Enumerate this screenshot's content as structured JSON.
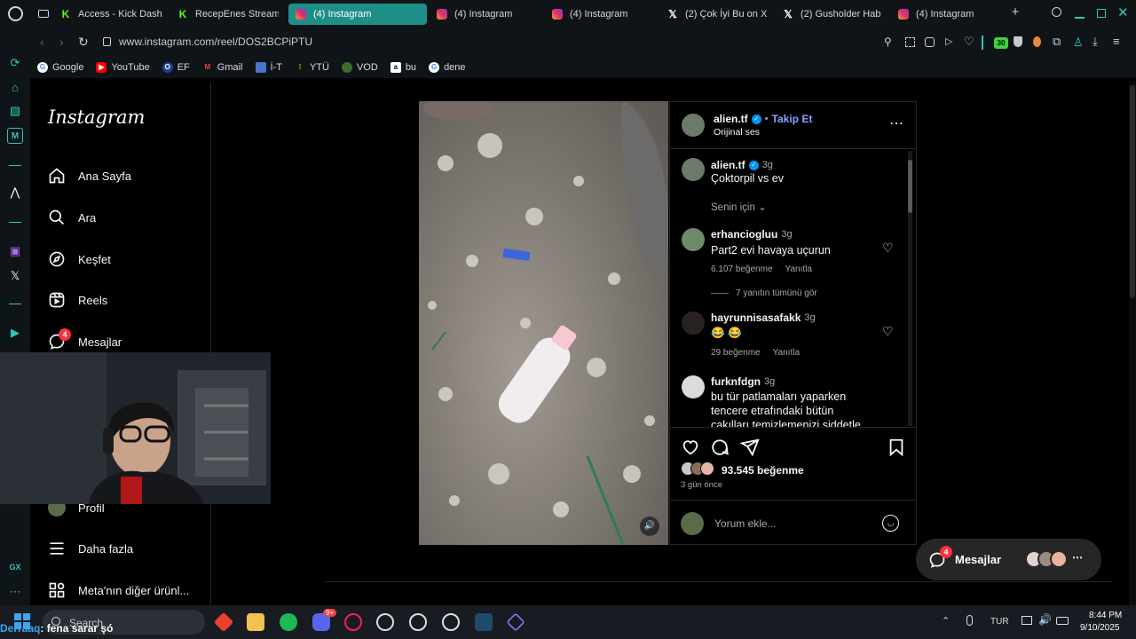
{
  "tabs": [
    {
      "label": "Access - Kick Dash",
      "icon": "kick-icon"
    },
    {
      "label": "RecepEnes Stream",
      "icon": "kick-icon"
    },
    {
      "label": "(4) Instagram",
      "icon": "instagram-icon",
      "active": true
    },
    {
      "label": "(4) Instagram",
      "icon": "instagram-icon"
    },
    {
      "label": "(4) Instagram",
      "icon": "instagram-icon"
    },
    {
      "label": "(2) Çok İyi Bu on X",
      "icon": "x-icon"
    },
    {
      "label": "(2) Gusholder Hab",
      "icon": "x-icon"
    },
    {
      "label": "(4) Instagram",
      "icon": "instagram-icon"
    }
  ],
  "address": {
    "url": "www.instagram.com/reel/DOS2BCPiPTU"
  },
  "bookmarks": [
    "Google",
    "YouTube",
    "EF",
    "Gmail",
    "İ-T",
    "YTÜ",
    "VOD",
    "bu",
    "dene"
  ],
  "toolbar": {
    "badge_count": "30"
  },
  "instagram": {
    "logo": "Instagram",
    "nav": {
      "home": "Ana Sayfa",
      "search": "Ara",
      "explore": "Keşfet",
      "reels": "Reels",
      "messages": "Mesajlar",
      "messages_badge": "4",
      "profile": "Profil",
      "more": "Daha fazla",
      "meta": "Meta'nın diğer ürünl..."
    }
  },
  "post": {
    "author": "alien.tf",
    "follow": "Takip Et",
    "dot": "•",
    "audio": "Orijinal ses",
    "caption_time": "3g",
    "caption": "Çoktorpil vs ev",
    "sort_label": "Senin için",
    "likes": "93.545 beğenme",
    "date": "3 gün önce",
    "comment_placeholder": "Yorum ekle..."
  },
  "comments": [
    {
      "user": "erhanciogluu",
      "time": "3g",
      "text": "Part2 evi havaya uçurun",
      "likes": "6.107 beğenme",
      "reply": "Yanıtla",
      "view_replies": "7 yanıtın tümünü gör"
    },
    {
      "user": "hayrunnisasafakk",
      "time": "3g",
      "text": "😂 😂",
      "likes": "29 beğenme",
      "reply": "Yanıtla"
    },
    {
      "user": "furknfdgn",
      "time": "3g",
      "text": "bu tür patlamaları yaparken tencere etrafındaki bütün çakılları temizlemenizi şiddetle"
    }
  ],
  "messages_pill": {
    "label": "Mesajlar",
    "badge": "4"
  },
  "overlay": {
    "chat_user": "Derraaq",
    "chat_text": ": fena sarar şó"
  },
  "taskbar": {
    "search": "Search",
    "discord_badge": "9+",
    "lang": "TUR",
    "time": "8:44 PM",
    "date": "9/10/2025"
  },
  "colors": {
    "accent": "#1e8f88",
    "follow_blue": "#85a1ff",
    "badge_red": "#ff3040"
  }
}
